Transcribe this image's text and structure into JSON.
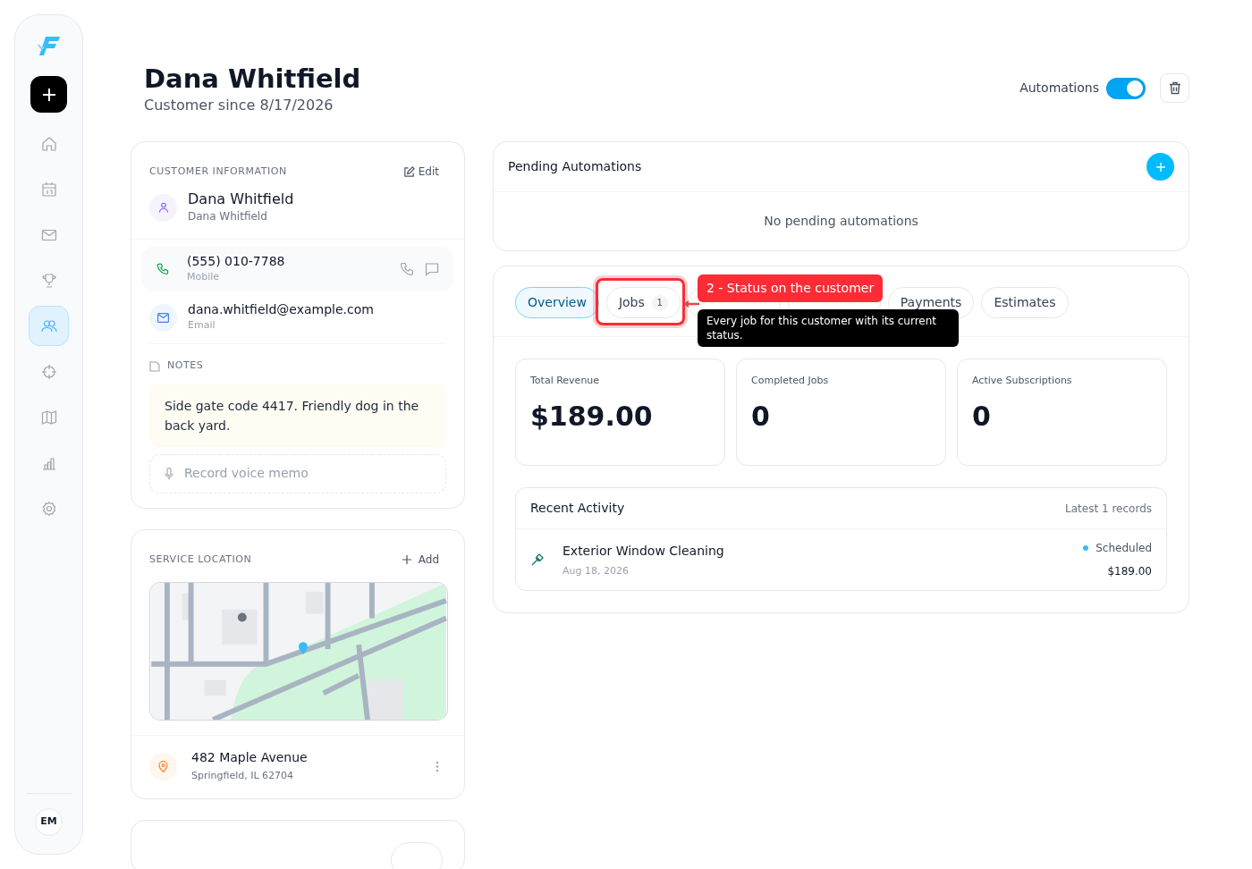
{
  "sidebar": {
    "items": [
      {
        "kind": "home",
        "selected": false
      },
      {
        "kind": "calendar",
        "selected": false
      },
      {
        "kind": "mail",
        "selected": false
      },
      {
        "kind": "trophy",
        "selected": false
      },
      {
        "kind": "users",
        "selected": true
      },
      {
        "kind": "crosshair",
        "selected": false
      },
      {
        "kind": "map",
        "selected": false
      },
      {
        "kind": "chart",
        "selected": false
      },
      {
        "kind": "settings",
        "selected": false
      }
    ],
    "user_initials": "EM"
  },
  "header": {
    "title": "Dana Whitfield",
    "subtitle": "Customer since 8/17/2026",
    "automations": {
      "label": "Automations",
      "on": true
    }
  },
  "customer_info": {
    "heading": "CUSTOMER INFORMATION",
    "edit_label": "Edit",
    "name": "Dana Whitfield",
    "subname": "Dana Whitfield",
    "phone": {
      "value": "(555) 010-7788",
      "label": "Mobile"
    },
    "email": {
      "value": "dana.whitfield@example.com",
      "label": "Email"
    },
    "notes_heading": "NOTES",
    "notes_text": "Side gate code 4417. Friendly dog in the back yard.",
    "voice_memo": "Record voice memo"
  },
  "service_location": {
    "heading": "SERVICE LOCATION",
    "add_label": "Add",
    "address": "482 Maple Avenue",
    "city": "Springfield, IL 62704"
  },
  "pending_automations": {
    "title": "Pending Automations",
    "empty_text": "No pending automations"
  },
  "tabs": [
    {
      "label": "Overview",
      "selected": true
    },
    {
      "label": "Jobs",
      "count": "1",
      "selected": false
    },
    {
      "selected": false
    },
    {
      "selected": false
    },
    {
      "label": "Payments",
      "selected": false
    },
    {
      "label": "Estimates",
      "selected": false
    }
  ],
  "annotation": {
    "label": "2 - Status on the customer",
    "tooltip": "Every job for this customer with its current status."
  },
  "stats": [
    {
      "label": "Total Revenue",
      "value": "$189.00"
    },
    {
      "label": "Completed Jobs",
      "value": "0"
    },
    {
      "label": "Active Subscriptions",
      "value": "0"
    }
  ],
  "recent_activity": {
    "title": "Recent Activity",
    "summary": "Latest 1 records",
    "items": [
      {
        "title": "Exterior Window Cleaning",
        "date": "Aug 18, 2026",
        "status": "Scheduled",
        "color": "#38bdf8",
        "amount": "$189.00"
      }
    ]
  }
}
